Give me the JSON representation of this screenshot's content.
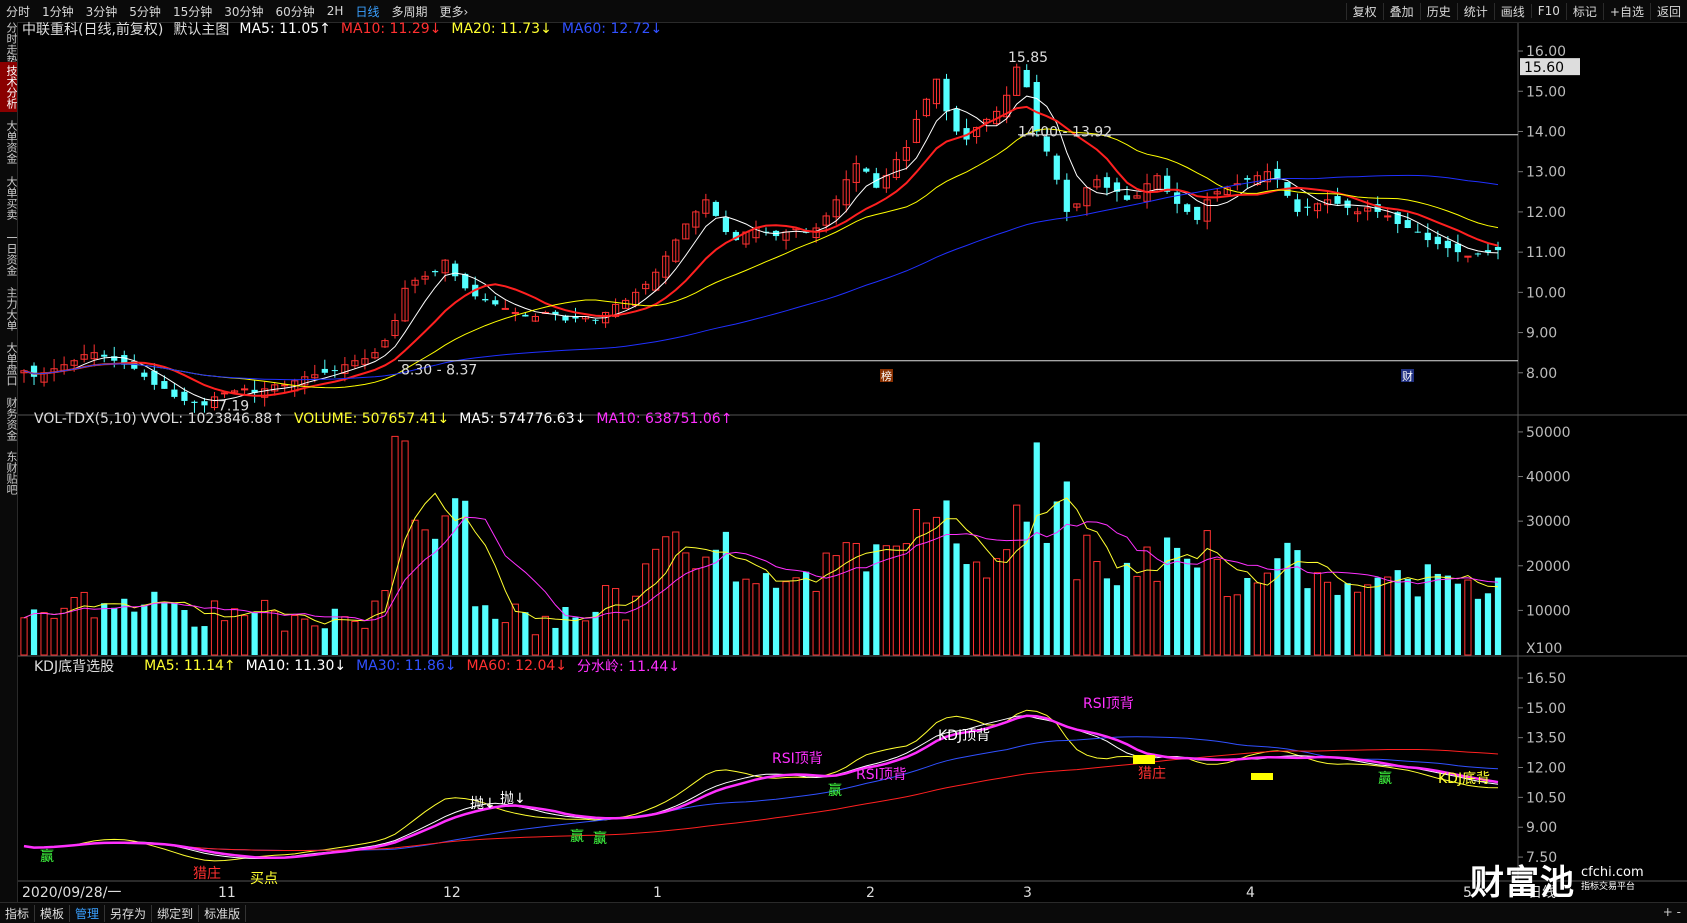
{
  "toolbar": {
    "periods": [
      "分时",
      "1分钟",
      "3分钟",
      "5分钟",
      "15分钟",
      "30分钟",
      "60分钟",
      "2H",
      "日线",
      "多周期",
      "更多›"
    ],
    "active_period": "日线",
    "right_buttons": [
      "复权",
      "叠加",
      "历史",
      "统计",
      "画线",
      "F10",
      "标记",
      "+自选",
      "返回"
    ]
  },
  "sidebar": {
    "tabs": [
      "分时走势",
      "技术分析",
      "大单资金",
      "大单买卖",
      "一日资金",
      "主力大单",
      "大单盘口",
      "财务资金",
      "东财贴吧"
    ],
    "active_tab": "技术分析"
  },
  "main_chart": {
    "title": "中联重科(日线,前复权)",
    "indicator_name": "默认主图",
    "ma5": "MA5: 11.05↑",
    "ma10": "MA10: 11.29↓",
    "ma20": "MA20: 11.73↓",
    "ma60": "MA60: 12.72↓",
    "price_ticks": [
      "16.00",
      "15.00",
      "14.00",
      "13.00",
      "12.00",
      "11.00",
      "10.00",
      "9.00",
      "8.00"
    ],
    "current_price": "15.60",
    "annotations": {
      "high": "15.85",
      "low": "7.19",
      "range_top": "14.00 - 13.92",
      "range_bottom": "8.30 - 8.37",
      "marker_bang": "榜",
      "marker_cai": "财"
    }
  },
  "volume_chart": {
    "name": "VOL-TDX(5,10)",
    "vvol": "VVOL: 1023846.88↑",
    "volume": "VOLUME: 507657.41↓",
    "ma5": "MA5: 574776.63↓",
    "ma10": "MA10: 638751.06↑",
    "ticks": [
      "50000",
      "40000",
      "30000",
      "20000",
      "10000"
    ],
    "unit": "X100"
  },
  "kdj_chart": {
    "name": "KDJ底背选股",
    "ma5": "MA5: 11.14↑",
    "ma10": "MA10: 11.30↓",
    "ma30": "MA30: 11.86↓",
    "ma60": "MA60: 12.04↓",
    "fenshuiling": "分水岭: 11.44↓",
    "ticks": [
      "16.50",
      "15.00",
      "13.50",
      "12.00",
      "10.50",
      "9.00",
      "7.50"
    ],
    "signals": {
      "ying": "赢",
      "liezhuang": "猎庄",
      "maidian": "买点",
      "pao": "抛↓",
      "rsi_top": "RSI顶背",
      "kdj_top": "KDJ顶背",
      "kdj_bottom": "KDJ底背"
    }
  },
  "time_axis": {
    "start": "2020/09/28/一",
    "months": [
      "11",
      "12",
      "1",
      "2",
      "3",
      "4",
      "5"
    ]
  },
  "bottom_tabs": [
    "指标",
    "模板",
    "管理",
    "另存为",
    "绑定到",
    "标准版"
  ],
  "bottom_active": "管理",
  "bottom_right": "+ -",
  "period_label": "日线",
  "watermark": {
    "brand": "财富池",
    "site": "cfchi.com",
    "slogan": "指标交易平台"
  },
  "colors": {
    "up": "#ff3232",
    "down": "#54ffff",
    "ma5": "#ffffff",
    "ma10": "#ff2020",
    "ma20": "#ffff00",
    "ma60": "#2030ff",
    "purple": "#ff30ff"
  },
  "chart_data": {
    "type": "candlestick",
    "title": "中联重科(日线,前复权)",
    "x_range": [
      "2020/09/28",
      "2021/05"
    ],
    "y_range": [
      7.19,
      15.85
    ],
    "series": [
      {
        "name": "MA5",
        "last": 11.05
      },
      {
        "name": "MA10",
        "last": 11.29
      },
      {
        "name": "MA20",
        "last": 11.73
      },
      {
        "name": "MA60",
        "last": 12.72
      }
    ],
    "close": [
      8.05,
      7.9,
      8.0,
      8.1,
      8.2,
      8.3,
      8.45,
      8.5,
      8.4,
      8.3,
      8.2,
      8.1,
      7.9,
      7.7,
      7.6,
      7.4,
      7.3,
      7.25,
      7.19,
      7.4,
      7.5,
      7.55,
      7.6,
      7.5,
      7.6,
      7.7,
      7.7,
      7.8,
      7.9,
      7.95,
      8.0,
      8.05,
      8.2,
      8.3,
      8.35,
      8.5,
      8.8,
      9.3,
      10.1,
      10.3,
      10.4,
      10.5,
      10.8,
      10.4,
      10.1,
      9.9,
      9.8,
      9.7,
      9.6,
      9.5,
      9.4,
      9.4,
      9.5,
      9.45,
      9.3,
      9.35,
      9.4,
      9.3,
      9.5,
      9.7,
      9.8,
      10.0,
      10.2,
      10.5,
      10.9,
      11.3,
      11.7,
      12.0,
      12.3,
      11.9,
      11.5,
      11.3,
      11.5,
      11.6,
      11.5,
      11.4,
      11.5,
      11.6,
      11.5,
      11.6,
      11.9,
      12.3,
      12.8,
      13.2,
      13.0,
      12.6,
      12.9,
      13.3,
      13.6,
      14.3,
      14.8,
      15.3,
      14.5,
      14.0,
      13.8,
      14.1,
      14.3,
      14.5,
      14.9,
      15.6,
      15.1,
      14.0,
      13.5,
      12.8,
      12.0,
      12.2,
      12.6,
      12.8,
      12.6,
      12.5,
      12.3,
      12.4,
      12.7,
      12.9,
      12.5,
      12.2,
      12.0,
      11.8,
      12.3,
      12.5,
      12.6,
      12.7,
      12.8,
      12.9,
      13.0,
      12.8,
      12.4,
      12.0,
      12.1,
      12.2,
      12.3,
      12.2,
      12.1,
      12.0,
      12.1,
      12.0,
      11.9,
      11.7,
      11.6,
      11.5,
      11.3,
      11.2,
      11.1,
      11.0,
      10.9,
      10.95,
      11.0,
      11.05
    ]
  }
}
